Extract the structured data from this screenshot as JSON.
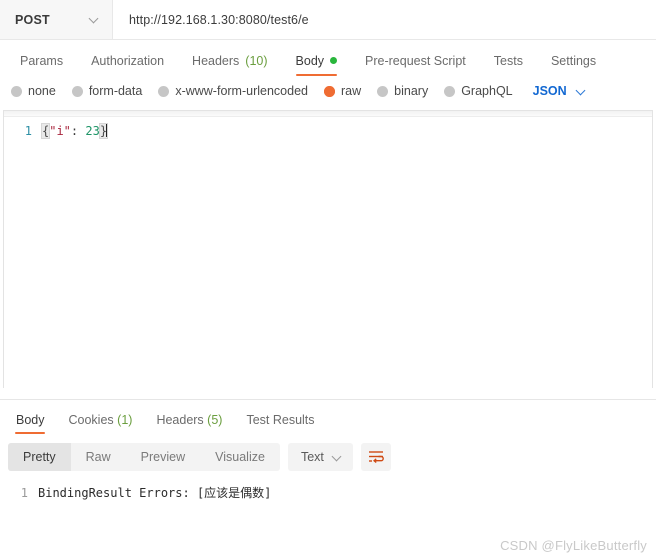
{
  "request": {
    "method": "POST",
    "url": "http://192.168.1.30:8080/test6/e",
    "tabs": [
      {
        "label": "Params",
        "count": "",
        "active": false,
        "dot": false
      },
      {
        "label": "Authorization",
        "count": "",
        "active": false,
        "dot": false
      },
      {
        "label": "Headers",
        "count": "(10)",
        "active": false,
        "dot": false
      },
      {
        "label": "Body",
        "count": "",
        "active": true,
        "dot": true
      },
      {
        "label": "Pre-request Script",
        "count": "",
        "active": false,
        "dot": false
      },
      {
        "label": "Tests",
        "count": "",
        "active": false,
        "dot": false
      },
      {
        "label": "Settings",
        "count": "",
        "active": false,
        "dot": false
      }
    ],
    "body_types": [
      {
        "label": "none",
        "selected": false
      },
      {
        "label": "form-data",
        "selected": false
      },
      {
        "label": "x-www-form-urlencoded",
        "selected": false
      },
      {
        "label": "raw",
        "selected": true
      },
      {
        "label": "binary",
        "selected": false
      },
      {
        "label": "GraphQL",
        "selected": false
      }
    ],
    "raw_format": "JSON",
    "editor": {
      "line_number": "1",
      "open_brace": "{",
      "key": "\"i\"",
      "colon": ":",
      "space": " ",
      "value": "23",
      "close_brace": "}"
    }
  },
  "response": {
    "tabs": [
      {
        "label": "Body",
        "count": "",
        "active": true
      },
      {
        "label": "Cookies",
        "count": "(1)",
        "active": false
      },
      {
        "label": "Headers",
        "count": "(5)",
        "active": false
      },
      {
        "label": "Test Results",
        "count": "",
        "active": false
      }
    ],
    "view_modes": [
      {
        "label": "Pretty",
        "active": true
      },
      {
        "label": "Raw",
        "active": false
      },
      {
        "label": "Preview",
        "active": false
      },
      {
        "label": "Visualize",
        "active": false
      }
    ],
    "format": "Text",
    "body": {
      "line_number": "1",
      "text": "BindingResult Errors: [应该是偶数]"
    }
  },
  "watermark": "CSDN @FlyLikeButterfly",
  "colors": {
    "accent_orange": "#ef6c33",
    "link_blue": "#1268d2",
    "count_green": "#6b9e3f",
    "dot_green": "#29b63c",
    "radio_gray": "#c6c6c6"
  }
}
